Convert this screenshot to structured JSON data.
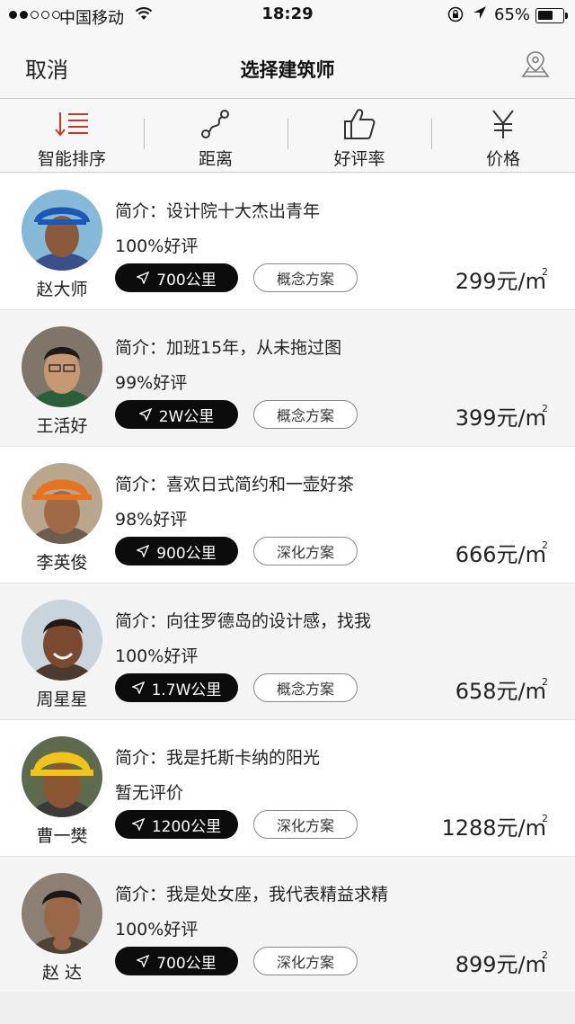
{
  "status_bar": {
    "carrier": "中国移动",
    "time": "18:29",
    "battery": "65%",
    "battery_level": 0.65
  },
  "nav": {
    "cancel": "取消",
    "title": "选择建筑师"
  },
  "sort_tabs": [
    {
      "label": "智能排序",
      "icon": "sort-lines-icon",
      "active": true
    },
    {
      "label": "距离",
      "icon": "route-icon"
    },
    {
      "label": "好评率",
      "icon": "thumbs-up-icon"
    },
    {
      "label": "价格",
      "icon": "yen-icon"
    }
  ],
  "colors": {
    "accent": "#c0392b",
    "pill": "#0c0c0c"
  },
  "architects": [
    {
      "name": "赵大师",
      "intro": "简介：设计院十大杰出青年",
      "rating": "100%好评",
      "distance": "700公里",
      "plan": "概念方案",
      "price": "299元/m",
      "sup": "2"
    },
    {
      "name": "王活好",
      "intro": "简介：加班15年，从未拖过图",
      "rating": "99%好评",
      "distance": "2W公里",
      "plan": "概念方案",
      "price": "399元/m",
      "sup": "2"
    },
    {
      "name": "李英俊",
      "intro": "简介：喜欢日式简约和一壶好茶",
      "rating": "98%好评",
      "distance": "900公里",
      "plan": "深化方案",
      "price": "666元/m",
      "sup": "2"
    },
    {
      "name": "周星星",
      "intro": "简介：向往罗德岛的设计感，找我",
      "rating": "100%好评",
      "distance": "1.7W公里",
      "plan": "概念方案",
      "price": "658元/m",
      "sup": "2"
    },
    {
      "name": "曹一樊",
      "intro": "简介：我是托斯卡纳的阳光",
      "rating": "暂无评价",
      "distance": "1200公里",
      "plan": "深化方案",
      "price": "1288元/m",
      "sup": "2"
    },
    {
      "name": "赵 达",
      "intro": "简介：我是处女座，我代表精益求精",
      "rating": "100%好评",
      "distance": "700公里",
      "plan": "深化方案",
      "price": "899元/m",
      "sup": "2"
    }
  ]
}
